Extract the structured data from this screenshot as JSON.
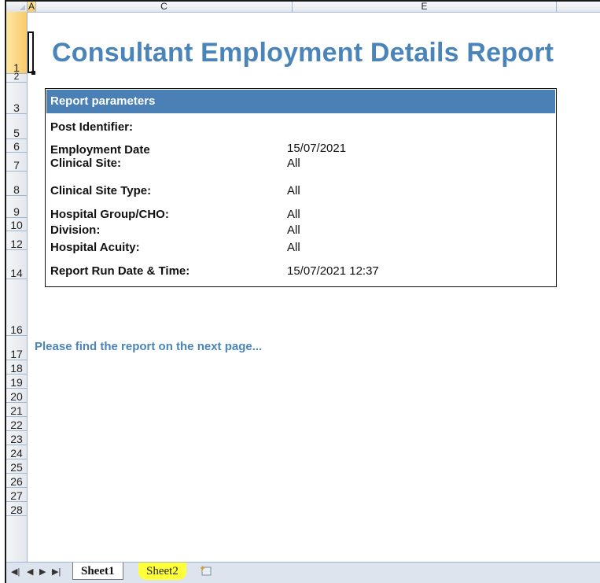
{
  "columns": [
    "A",
    "C",
    "E"
  ],
  "rows": [
    "1",
    "2",
    "3",
    "5",
    "6",
    "7",
    "8",
    "9",
    "10",
    "12",
    "14",
    "16",
    "17",
    "18",
    "19",
    "20",
    "21",
    "22",
    "23",
    "24",
    "25",
    "26",
    "27",
    "28"
  ],
  "report": {
    "title": "Consultant Employment Details Report",
    "params_header": "Report parameters",
    "params": [
      {
        "label": "Post Identifier:",
        "value": ""
      },
      {
        "label": "Employment Date",
        "value": "15/07/2021"
      },
      {
        "label": "Clinical Site:",
        "value": "All"
      },
      {
        "label": "Clinical Site Type:",
        "value": "All"
      },
      {
        "label": "Hospital Group/CHO:",
        "value": "All"
      },
      {
        "label": "Division:",
        "value": "All"
      },
      {
        "label": "Hospital Acuity:",
        "value": "All"
      },
      {
        "label": "Report Run Date & Time:",
        "value": "15/07/2021 12:37"
      }
    ],
    "note": "Please find the report on the next page..."
  },
  "tabs": {
    "sheet1": "Sheet1",
    "sheet2": "Sheet2"
  },
  "colors": {
    "title_blue": "#4a84b8",
    "header_bar": "#4a80b6",
    "highlight": "#ffff3a"
  }
}
